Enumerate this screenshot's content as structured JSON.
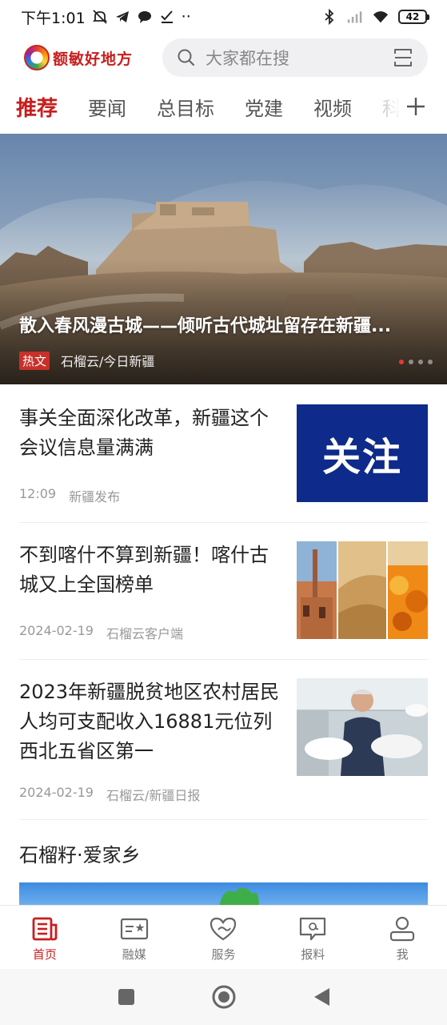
{
  "status_bar": {
    "time": "下午1:01",
    "dots": "··",
    "battery": "42"
  },
  "header": {
    "logo_text": "额敏好地方",
    "search_placeholder": "大家都在搜"
  },
  "tabs": [
    "推荐",
    "要闻",
    "总目标",
    "党建",
    "视频",
    "科"
  ],
  "hero": {
    "title": "散入春风漫古城——倾听古代城址留存在新疆...",
    "badge": "热文",
    "source": "石榴云/今日新疆"
  },
  "articles": [
    {
      "title": "事关全面深化改革，新疆这个会议信息量满满",
      "time": "12:09",
      "source": "新疆发布",
      "thumb_text": "关注"
    },
    {
      "title": "不到喀什不算到新疆！喀什古城又上全国榜单",
      "time": "2024-02-19",
      "source": "石榴云客户端"
    },
    {
      "title": "2023年新疆脱贫地区农村居民人均可支配收入16881元位列西北五省区第一",
      "time": "2024-02-19",
      "source": "石榴云/新疆日报"
    }
  ],
  "section": {
    "title": "石榴籽·爱家乡"
  },
  "bottom_nav": [
    {
      "label": "首页",
      "icon": "home-news-icon"
    },
    {
      "label": "融媒",
      "icon": "media-icon"
    },
    {
      "label": "服务",
      "icon": "service-heart-icon"
    },
    {
      "label": "报料",
      "icon": "report-chat-icon"
    },
    {
      "label": "我",
      "icon": "user-icon"
    }
  ],
  "colors": {
    "accent": "#c81e1e",
    "thumb_blue": "#0e2a8a"
  }
}
